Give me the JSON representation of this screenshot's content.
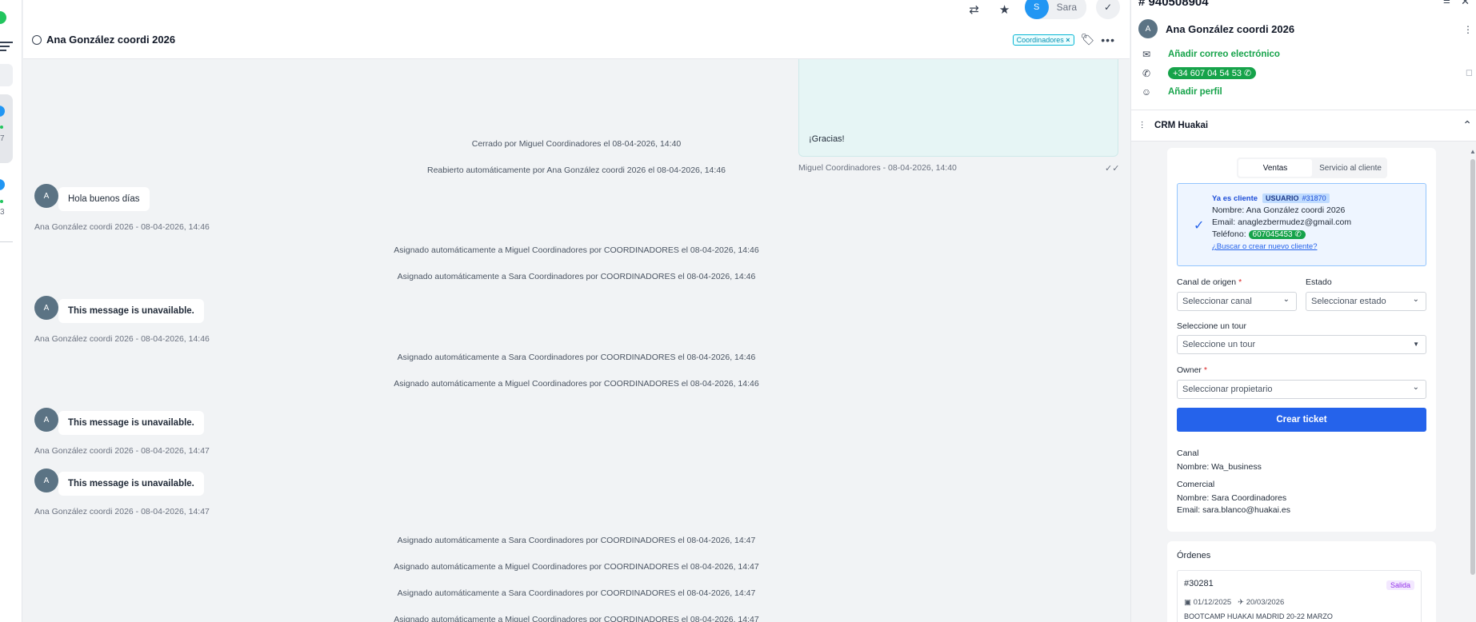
{
  "left": {
    "counts": [
      "7",
      "3"
    ]
  },
  "header": {
    "title": "Ana González coordi 2026",
    "tag": "Coordinadores",
    "agent_initial": "S",
    "agent_name": "Sara"
  },
  "chat": {
    "outgoing": {
      "text": "¡Gracias!",
      "meta": "Miguel Coordinadores  - 08-04-2026, 14:40"
    },
    "events": [
      {
        "kind": "sys",
        "text": "Cerrado por Miguel Coordinadores el 08-04-2026, 14:40"
      },
      {
        "kind": "sys",
        "text": "Reabierto automáticamente por Ana González coordi 2026 el 08-04-2026, 14:46"
      },
      {
        "kind": "in",
        "text": "Hola buenos días",
        "bold": false,
        "meta": "Ana González coordi 2026  - 08-04-2026, 14:46"
      },
      {
        "kind": "sys",
        "text": "Asignado automáticamente a Miguel Coordinadores por COORDINADORES el 08-04-2026, 14:46"
      },
      {
        "kind": "sys",
        "text": "Asignado automáticamente a Sara Coordinadores por COORDINADORES el 08-04-2026, 14:46"
      },
      {
        "kind": "in",
        "text": "This message is unavailable.",
        "bold": true,
        "meta": "Ana González coordi 2026  - 08-04-2026, 14:46"
      },
      {
        "kind": "sys",
        "text": "Asignado automáticamente a Sara Coordinadores por COORDINADORES el 08-04-2026, 14:46"
      },
      {
        "kind": "sys",
        "text": "Asignado automáticamente a Miguel Coordinadores por COORDINADORES el 08-04-2026, 14:46"
      },
      {
        "kind": "in",
        "text": "This message is unavailable.",
        "bold": true,
        "meta": "Ana González coordi 2026  - 08-04-2026, 14:47"
      },
      {
        "kind": "in",
        "text": "This message is unavailable.",
        "bold": true,
        "meta": "Ana González coordi 2026  - 08-04-2026, 14:47"
      },
      {
        "kind": "sys",
        "text": "Asignado automáticamente a Sara Coordinadores por COORDINADORES el 08-04-2026, 14:47"
      },
      {
        "kind": "sys",
        "text": "Asignado automáticamente a Miguel Coordinadores por COORDINADORES el 08-04-2026, 14:47"
      },
      {
        "kind": "sys",
        "text": "Asignado automáticamente a Sara Coordinadores por COORDINADORES el 08-04-2026, 14:47"
      },
      {
        "kind": "sys",
        "text": "Asignado automáticamente a Miguel Coordinadores por COORDINADORES el 08-04-2026, 14:47"
      }
    ],
    "avatar_initial": "A"
  },
  "panel": {
    "ticket": "# 940508904",
    "contact_initial": "A",
    "contact_name": "Ana González coordi 2026",
    "add_email": "Añadir correo electrónico",
    "phone": "+34 607 04 54 53 ✆",
    "add_profile": "Añadir perfil",
    "crm_title": "CRM Huakai",
    "tabs": [
      "Ventas",
      "Servicio al cliente"
    ],
    "client": {
      "status": "Ya es cliente",
      "badge": "USUARIO",
      "badge_id": "#31870",
      "name_label": "Nombre:",
      "name": "Ana González coordi 2026",
      "email_label": "Email:",
      "email": "anaglezbermudez@gmail.com",
      "phone_label": "Teléfono:",
      "phone": "607045453 ✆",
      "link": "¿Buscar o crear nuevo cliente?"
    },
    "form": {
      "canal_label": "Canal de origen",
      "canal_placeholder": "Seleccionar canal",
      "estado_label": "Estado",
      "estado_placeholder": "Seleccionar estado",
      "tour_label": "Seleccione un tour",
      "tour_placeholder": "Seleccione un tour",
      "owner_label": "Owner",
      "owner_placeholder": "Seleccionar propietario",
      "required_mark": "*",
      "submit": "Crear ticket"
    },
    "canal": {
      "title": "Canal",
      "line": "Nombre: Wa_business"
    },
    "comercial": {
      "title": "Comercial",
      "name_line": "Nombre: Sara Coordinadores",
      "email_line": "Email: sara.blanco@huakai.es"
    },
    "orders": {
      "title": "Órdenes",
      "item": {
        "number": "#30281",
        "badge": "Salida",
        "date_start": "01/12/2025",
        "date_end": "20/03/2026",
        "name": "BOOTCAMP HUAKAI MADRID 20-22 MARZO"
      }
    }
  }
}
